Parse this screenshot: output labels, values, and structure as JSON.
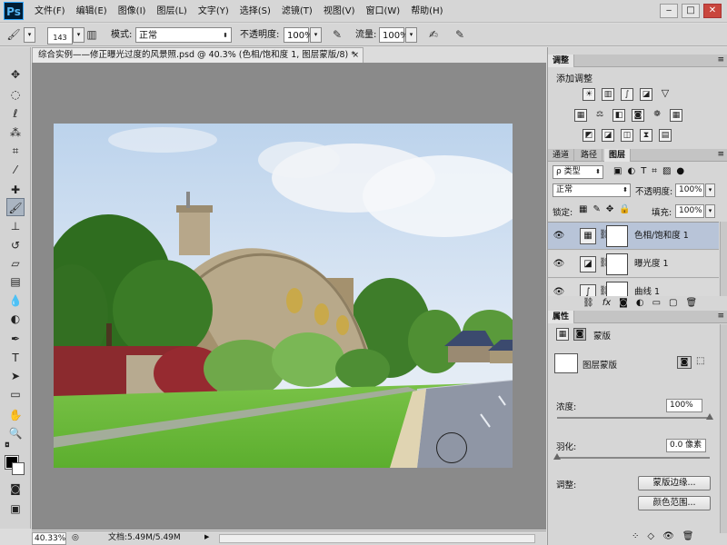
{
  "app": {
    "logo": "Ps",
    "menu": [
      "文件(F)",
      "编辑(E)",
      "图像(I)",
      "图层(L)",
      "文字(Y)",
      "选择(S)",
      "滤镜(T)",
      "视图(V)",
      "窗口(W)",
      "帮助(H)"
    ],
    "window_controls": {
      "minimize": "‒",
      "restore": "□",
      "close": "✕"
    }
  },
  "options_bar": {
    "brush_size": "143",
    "mode_label": "模式:",
    "mode_value": "正常",
    "opacity_label": "不透明度:",
    "opacity_value": "100%",
    "flow_label": "流量:",
    "flow_value": "100%"
  },
  "document": {
    "tab_title": "综合实例——修正曝光过度的风景照.psd @ 40.3% (色相/饱和度 1, 图层蒙版/8) *",
    "close": "×"
  },
  "status": {
    "zoom": "40.33%",
    "doc_info": "文档:5.49M/5.49M"
  },
  "adjustments_panel": {
    "tab": "调整",
    "title": "添加调整",
    "row1_icons": [
      "brightness-icon",
      "levels-icon",
      "curves-icon",
      "exposure-icon",
      "vibrance-icon"
    ],
    "row2_icons": [
      "hue-saturation-icon",
      "color-balance-icon",
      "black-white-icon",
      "photo-filter-icon",
      "channel-mixer-icon",
      "color-lookup-icon"
    ],
    "row3_icons": [
      "invert-icon",
      "posterize-icon",
      "threshold-icon",
      "selective-color-icon",
      "gradient-map-icon"
    ]
  },
  "layers_panel": {
    "tabs": [
      "通道",
      "路径",
      "图层"
    ],
    "active_tab": "图层",
    "filter_label": "ρ 类型",
    "blend_mode": "正常",
    "opacity_label": "不透明度:",
    "opacity_value": "100%",
    "lock_label": "锁定:",
    "fill_label": "填充:",
    "fill_value": "100%",
    "layers": [
      {
        "name": "色相/饱和度 1",
        "selected": true
      },
      {
        "name": "曝光度 1",
        "selected": false
      },
      {
        "name": "曲线 1",
        "selected": false
      }
    ]
  },
  "properties_panel": {
    "tab": "属性",
    "mask_label": "蒙版",
    "layer_mask_label": "图层蒙版",
    "density_label": "浓度:",
    "density_value": "100%",
    "density": 1.0,
    "feather_label": "羽化:",
    "feather_value": "0.0 像素",
    "feather": 0.0,
    "refine_label": "调整:",
    "mask_edge_button": "蒙版边缘...",
    "color_range_button": "颜色范围..."
  }
}
